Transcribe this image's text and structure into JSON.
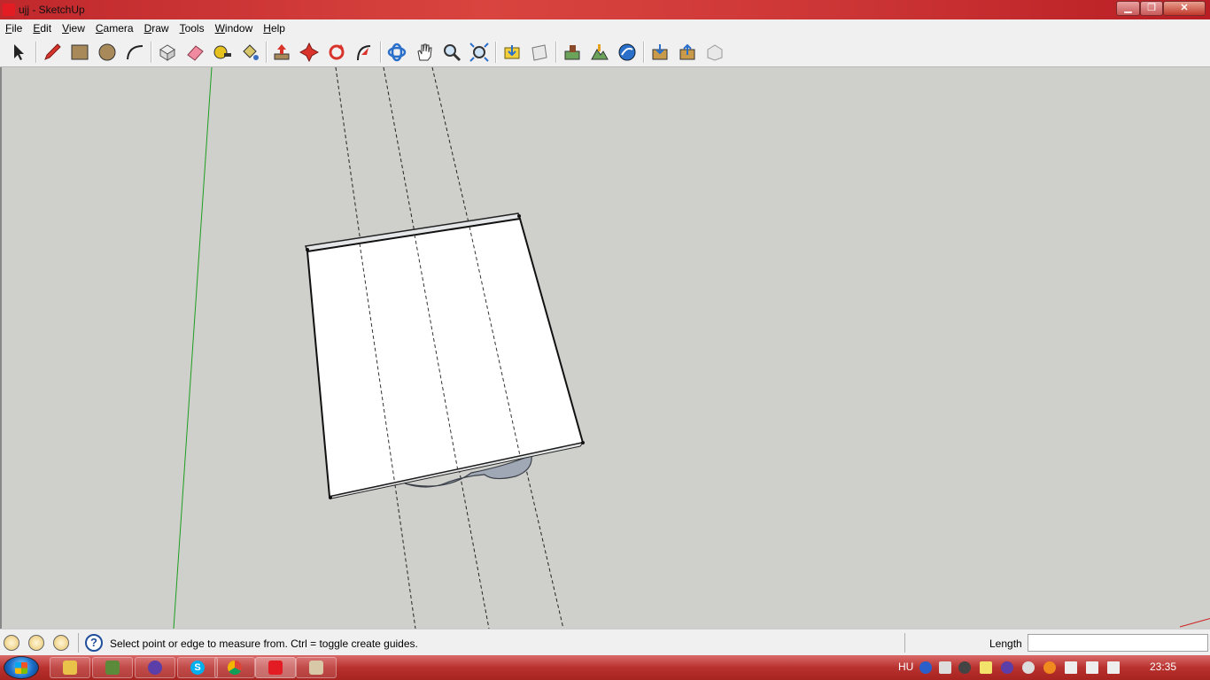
{
  "window": {
    "title": "ujj - SketchUp",
    "minimize": "▁",
    "maximize": "❐",
    "close": "✕"
  },
  "menu": [
    "File",
    "Edit",
    "View",
    "Camera",
    "Draw",
    "Tools",
    "Window",
    "Help"
  ],
  "toolbar": {
    "tools": [
      "select-tool",
      "pencil-tool",
      "rectangle-tool",
      "circle-tool",
      "arc-tool",
      "make-component-tool",
      "eraser-tool",
      "tape-measure-tool",
      "paint-bucket-tool",
      "push-pull-tool",
      "move-tool",
      "rotate-tool",
      "follow-me-tool",
      "orbit-tool",
      "pan-tool",
      "zoom-tool",
      "zoom-extents-tool",
      "get-models-tool",
      "share-model-tool",
      "add-location-tool",
      "toggle-terrain-tool",
      "google-earth-tool",
      "warehouse-tool",
      "share-component-tool",
      "extension-tool"
    ]
  },
  "status": {
    "message": "Select point or edge to measure from.  Ctrl = toggle create guides.",
    "help_glyph": "?",
    "vcb_label": "Length",
    "vcb_value": ""
  },
  "taskbar": {
    "apps": [
      "file-explorer",
      "minecraft",
      "browser-purple",
      "skype",
      "chrome",
      "sketchup",
      "photo-gallery"
    ],
    "tray": {
      "language": "HU",
      "time": "23:35"
    }
  },
  "colors": {
    "green_axis": "#1e9e1e",
    "red_axis": "#cc2222",
    "canvas": "#cfcfcb",
    "accent_red": "#e31b23"
  }
}
